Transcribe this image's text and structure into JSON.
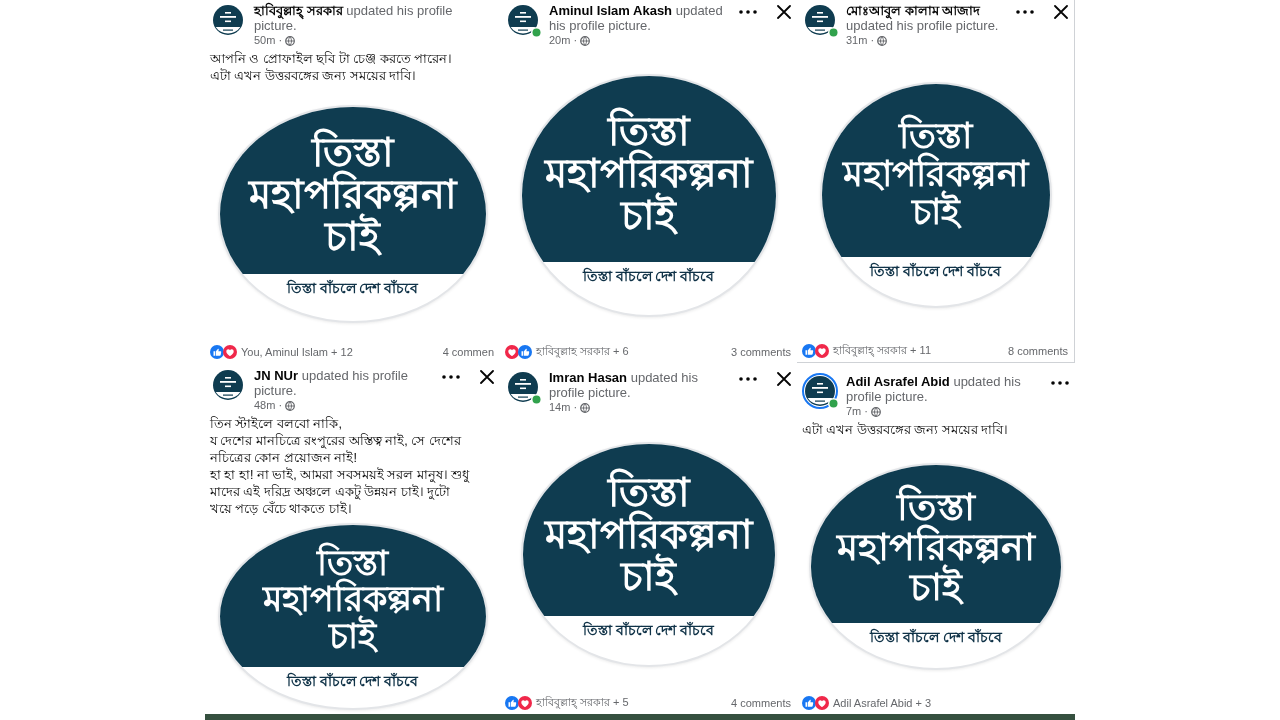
{
  "posts": [
    {
      "author": "হাবিবুল্লাহ্ সরকার",
      "action": "updated his profile picture.",
      "time": "50m ·",
      "online": false,
      "story_ring": false,
      "body_lines": [
        "আপনি ও প্রোফাইল ছবি টা চেঞ্জ করতে পারেন।",
        "এটা এখন উত্তরবঙ্গের জন্য সময়ের দাবি।"
      ],
      "banner": {
        "title_lines": [
          "তিস্তা",
          "মহাপরিকল্পনা",
          "চাই"
        ],
        "caption": "তিস্তা বাঁচলে দেশ বাঁচবে"
      },
      "reactions": {
        "icons": [
          {
            "kind": "like"
          },
          {
            "kind": "love"
          }
        ],
        "names": "You, Aminul Islam + 12",
        "comments": "4 commen"
      }
    },
    {
      "author": "Aminul Islam Akash",
      "action": "updated his profile picture.",
      "time": "20m ·",
      "online": true,
      "story_ring": false,
      "menu_buttons": [
        {
          "kind": "more"
        },
        {
          "kind": "close"
        }
      ],
      "banner": {
        "title_lines": [
          "তিস্তা",
          "মহাপরিকল্পনা",
          "চাই"
        ],
        "caption": "তিস্তা বাঁচলে দেশ বাঁচবে"
      },
      "reactions": {
        "icons": [
          {
            "kind": "love"
          },
          {
            "kind": "like"
          }
        ],
        "names": "হাবিবুল্লাহ সরকার + 6",
        "comments": "3 comments"
      }
    },
    {
      "author": "মোঃআবুল কালাম আজাদ",
      "action": "updated his profile picture.",
      "time": "31m ·",
      "online": true,
      "story_ring": false,
      "menu_buttons": [
        {
          "kind": "more"
        },
        {
          "kind": "close"
        }
      ],
      "banner": {
        "title_lines": [
          "তিস্তা",
          "মহাপরিকল্পনা",
          "চাই"
        ],
        "caption": "তিস্তা বাঁচলে দেশ বাঁচবে"
      },
      "reactions": {
        "icons": [
          {
            "kind": "like"
          },
          {
            "kind": "love"
          }
        ],
        "names": "হাবিবুল্লাহ্ সরকার + 11",
        "comments": "8 comments"
      }
    },
    {
      "author": "JN NUr",
      "action": "updated his profile picture.",
      "time": "48m ·",
      "online": false,
      "story_ring": false,
      "menu_buttons": [
        {
          "kind": "more"
        },
        {
          "kind": "close"
        }
      ],
      "body_lines": [
        "তিন স্টাইলে বলবো নাকি,",
        "য দেশের মানচিত্রে রংপুরের অস্তিত্ব নাই, সে দেশের",
        "নচিত্রের কোন প্রয়োজন নাই!",
        "হা হা হা!  না ভাই, আমরা সবসময়ই সরল মানুষ। শুধু",
        "মাদের এই দরিদ্র অঞ্চলে একটু উন্নয়ন চাই। দুটো",
        "খয়ে পড়ে বেঁচে থাকতে চাই।"
      ],
      "banner": {
        "title_lines": [
          "তিস্তা",
          "মহাপরিকল্পনা",
          "চাই"
        ],
        "caption": "তিস্তা বাঁচলে দেশ বাঁচবে"
      }
    },
    {
      "author": "Imran Hasan",
      "action": "updated his profile picture.",
      "time": "14m ·",
      "online": true,
      "story_ring": false,
      "menu_buttons": [
        {
          "kind": "more"
        },
        {
          "kind": "close"
        }
      ],
      "banner": {
        "title_lines": [
          "তিস্তা",
          "মহাপরিকল্পনা",
          "চাই"
        ],
        "caption": "তিস্তা বাঁচলে দেশ বাঁচবে"
      },
      "reactions": {
        "icons": [
          {
            "kind": "like"
          },
          {
            "kind": "love"
          }
        ],
        "names": "হাবিবুল্লাহ্ সরকার + 5",
        "comments": "4 comments"
      }
    },
    {
      "author": "Adil Asrafel Abid",
      "action": "updated his profile picture.",
      "time": "7m ·",
      "online": true,
      "story_ring": true,
      "menu_buttons": [
        {
          "kind": "more"
        }
      ],
      "body_lines": [
        "এটা এখন উত্তরবঙ্গের জন্য সময়ের দাবি।"
      ],
      "banner": {
        "title_lines": [
          "তিস্তা",
          "মহাপরিকল্পনা",
          "চাই"
        ],
        "caption": "তিস্তা বাঁচলে দেশ বাঁচবে"
      },
      "reactions": {
        "icons": [
          {
            "kind": "like"
          },
          {
            "kind": "love"
          }
        ],
        "names": "Adil Asrafel Abid + 3"
      }
    }
  ]
}
